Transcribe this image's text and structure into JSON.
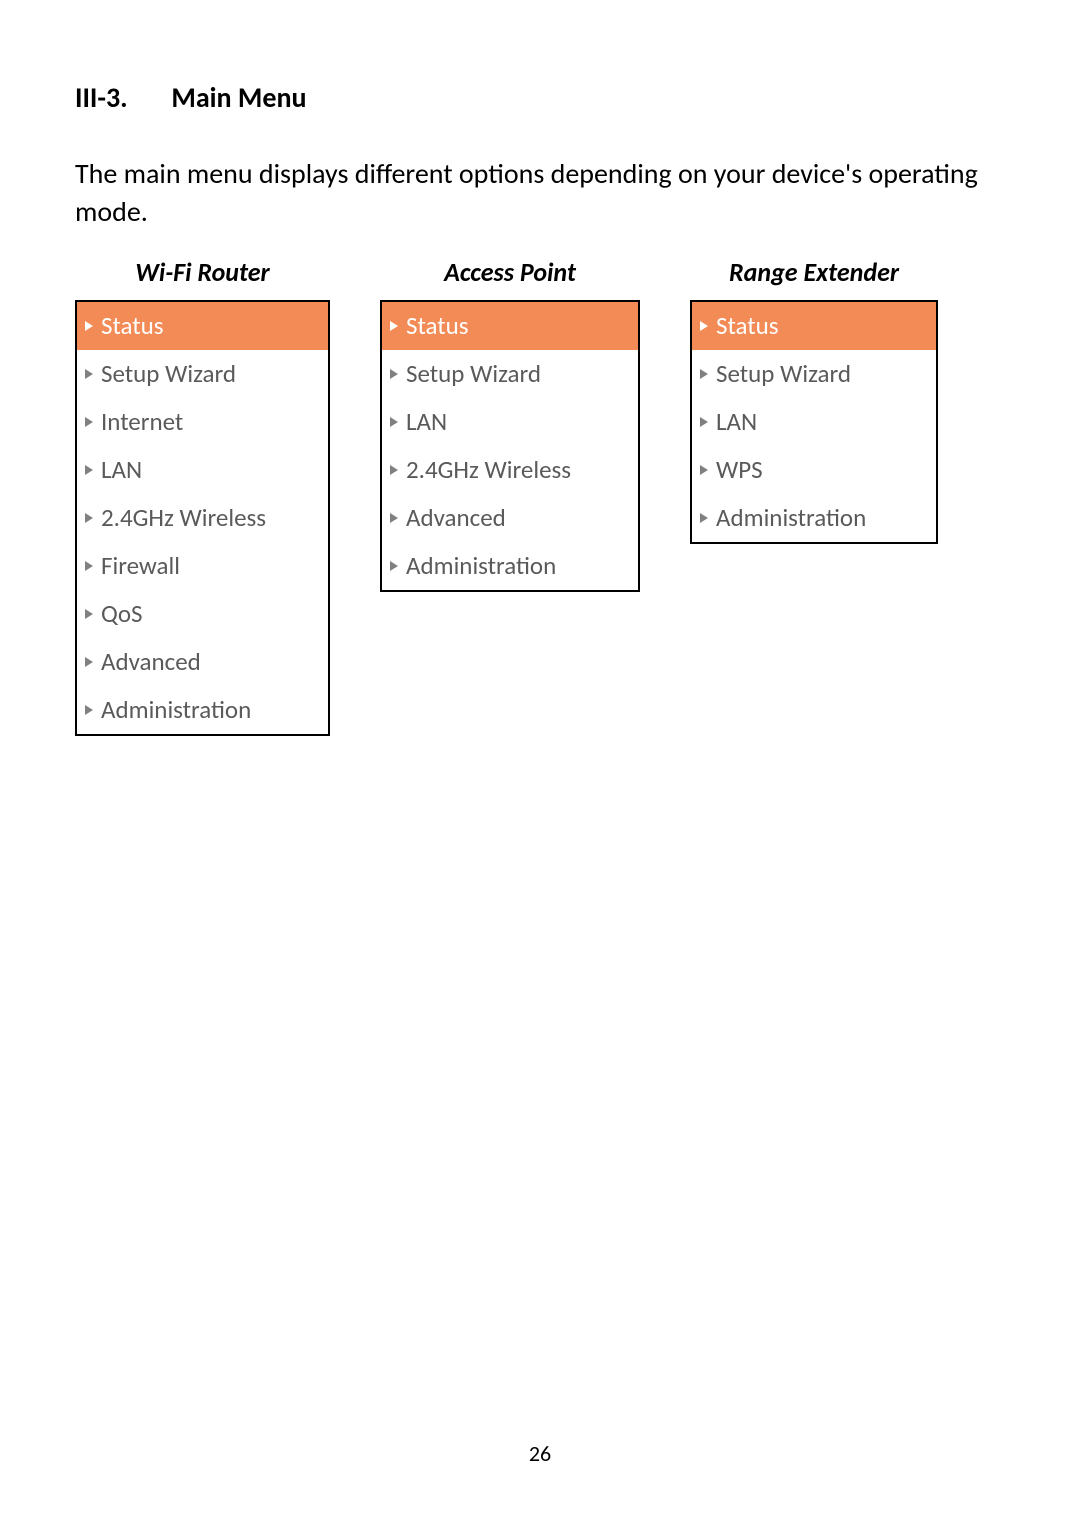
{
  "heading": {
    "number": "III-3.",
    "title": "Main Menu"
  },
  "intro": "The main menu displays different options depending on your device's operating mode.",
  "columns": [
    {
      "title": "Wi-Fi Router",
      "cls": "router",
      "items": [
        {
          "label": "Status",
          "highlight": true
        },
        {
          "label": "Setup Wizard"
        },
        {
          "label": "Internet"
        },
        {
          "label": "LAN"
        },
        {
          "label": "2.4GHz Wireless"
        },
        {
          "label": "Firewall"
        },
        {
          "label": "QoS"
        },
        {
          "label": "Advanced"
        },
        {
          "label": "Administration"
        }
      ]
    },
    {
      "title": "Access Point",
      "cls": "ap",
      "items": [
        {
          "label": "Status",
          "highlight": true
        },
        {
          "label": "Setup Wizard"
        },
        {
          "label": "LAN"
        },
        {
          "label": "2.4GHz Wireless"
        },
        {
          "label": "Advanced"
        },
        {
          "label": "Administration"
        }
      ]
    },
    {
      "title": "Range Extender",
      "cls": "extender",
      "items": [
        {
          "label": "Status",
          "highlight": true
        },
        {
          "label": "Setup Wizard"
        },
        {
          "label": "LAN"
        },
        {
          "label": "WPS"
        },
        {
          "label": "Administration"
        }
      ]
    }
  ],
  "pageNumber": "26"
}
